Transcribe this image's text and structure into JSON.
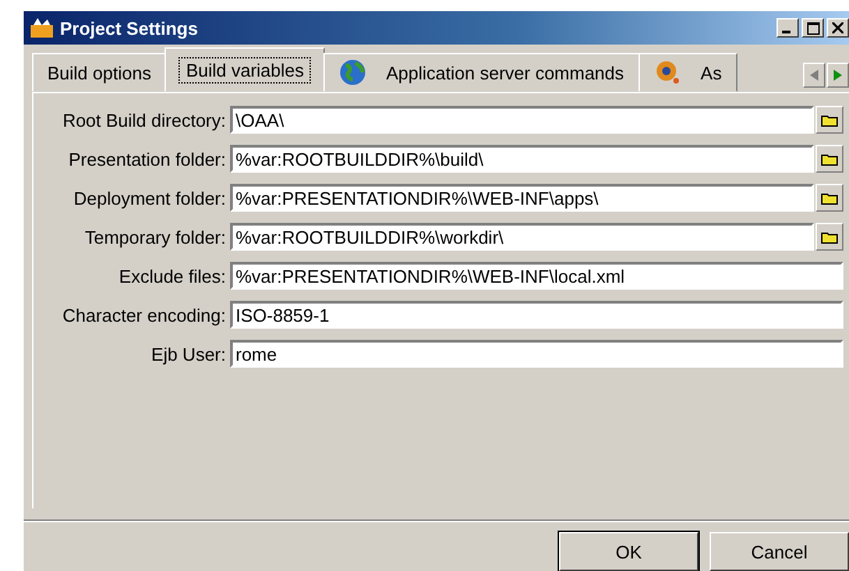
{
  "window": {
    "title": "Project Settings"
  },
  "tabs": [
    {
      "label": "Build options",
      "selected": false
    },
    {
      "label": "Build variables",
      "selected": true
    },
    {
      "label": "Application server commands",
      "selected": false
    },
    {
      "label": "As",
      "selected": false
    }
  ],
  "fields": [
    {
      "label": "Root Build directory:",
      "value": "\\OAA\\",
      "browse": true
    },
    {
      "label": "Presentation folder:",
      "value": "%var:ROOTBUILDDIR%\\build\\",
      "browse": true
    },
    {
      "label": "Deployment folder:",
      "value": "%var:PRESENTATIONDIR%\\WEB-INF\\apps\\",
      "browse": true
    },
    {
      "label": "Temporary folder:",
      "value": "%var:ROOTBUILDDIR%\\workdir\\",
      "browse": true
    },
    {
      "label": "Exclude files:",
      "value": "%var:PRESENTATIONDIR%\\WEB-INF\\local.xml",
      "browse": false
    },
    {
      "label": "Character encoding:",
      "value": "ISO-8859-1",
      "browse": false
    },
    {
      "label": "Ejb User:",
      "value": "rome",
      "browse": false
    }
  ],
  "buttons": [
    {
      "label": "OK",
      "default": true
    },
    {
      "label": "Cancel",
      "default": false
    }
  ]
}
